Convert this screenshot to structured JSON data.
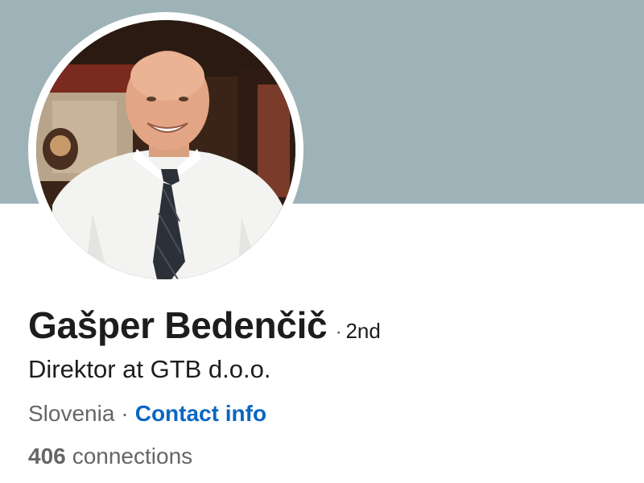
{
  "profile": {
    "name": "Gašper Bedenčič",
    "degree_separator": "·",
    "degree": "2nd",
    "headline": "Direktor at GTB d.o.o.",
    "location": "Slovenia",
    "meta_separator": "·",
    "contact_info_label": "Contact info",
    "connections_count": "406",
    "connections_label": "connections"
  },
  "colors": {
    "cover_background": "#9eb3b7",
    "link": "#0a66c2",
    "primary_text": "#1d1d1d",
    "secondary_text": "#666666"
  }
}
